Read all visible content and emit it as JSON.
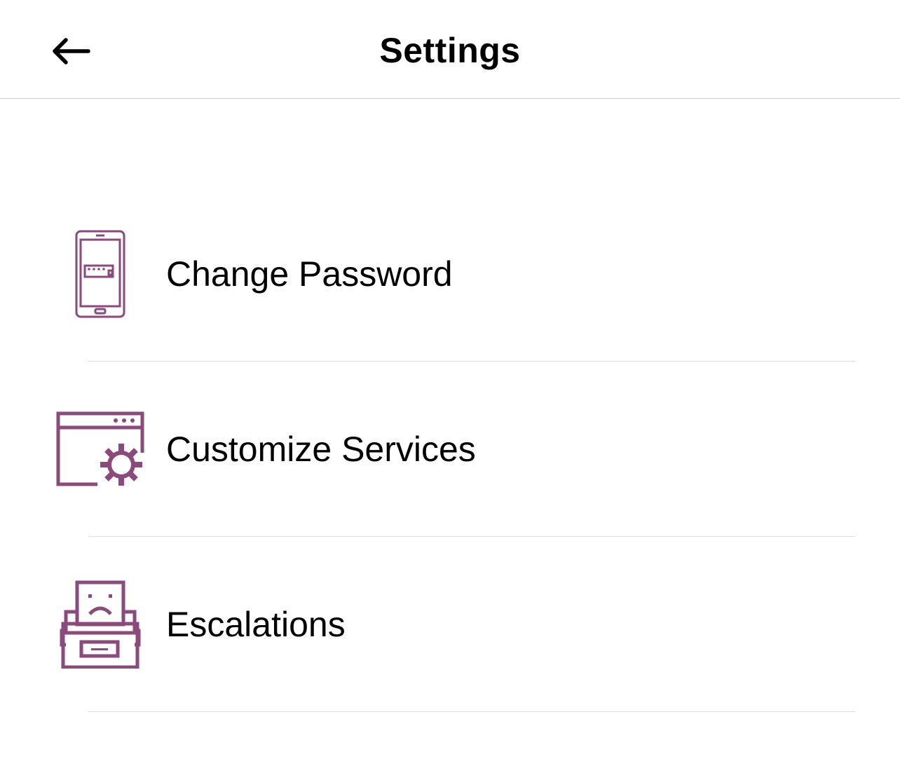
{
  "header": {
    "title": "Settings",
    "back_icon": "arrow-left-icon"
  },
  "accent_color": "#8a4a7b",
  "settings": {
    "items": [
      {
        "label": "Change Password",
        "icon": "phone-password-icon"
      },
      {
        "label": "Customize Services",
        "icon": "window-gear-icon"
      },
      {
        "label": "Escalations",
        "icon": "sad-printer-icon"
      }
    ]
  }
}
